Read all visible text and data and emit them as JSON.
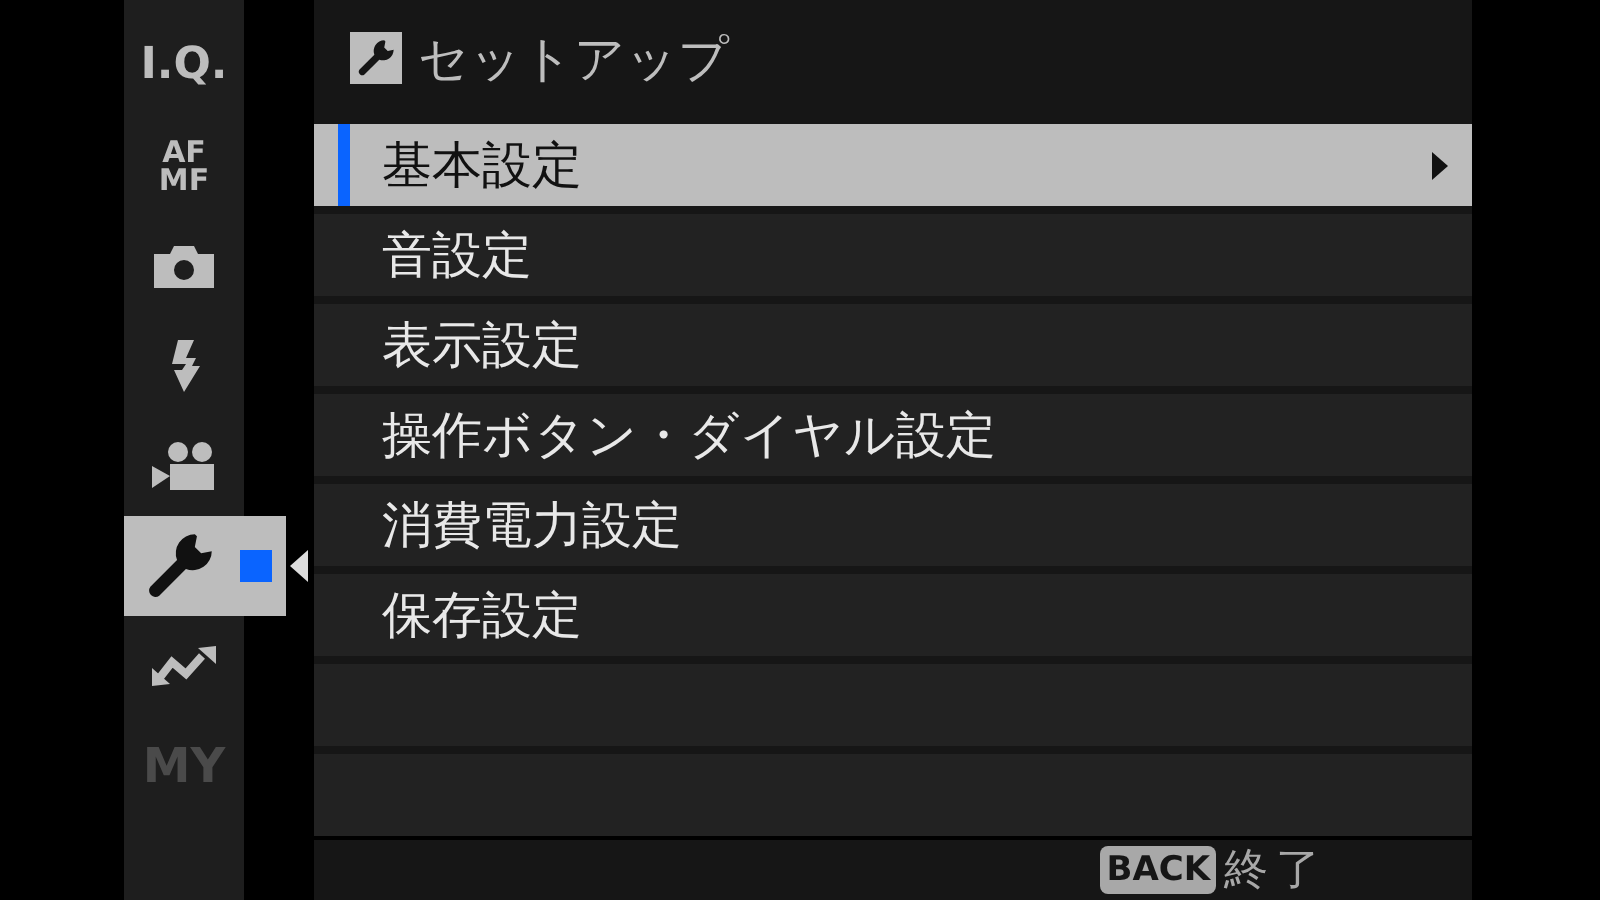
{
  "sidebar": {
    "items": [
      {
        "kind": "text",
        "label": "I.Q.",
        "selected": false,
        "disabled": false
      },
      {
        "kind": "text",
        "label": "AF\nMF",
        "selected": false,
        "disabled": false
      },
      {
        "kind": "icon",
        "selected": false,
        "disabled": false
      },
      {
        "kind": "icon",
        "selected": false,
        "disabled": false
      },
      {
        "kind": "icon",
        "selected": false,
        "disabled": false
      },
      {
        "kind": "icon",
        "selected": true,
        "disabled": false
      },
      {
        "kind": "icon",
        "selected": false,
        "disabled": false
      },
      {
        "kind": "text",
        "label": "MY",
        "selected": false,
        "disabled": true
      }
    ]
  },
  "menu": {
    "title": "セットアップ",
    "items": [
      {
        "label": "基本設定",
        "selected": true
      },
      {
        "label": "音設定",
        "selected": false
      },
      {
        "label": "表示設定",
        "selected": false
      },
      {
        "label": "操作ボタン・ダイヤル設定",
        "selected": false
      },
      {
        "label": "消費電力設定",
        "selected": false
      },
      {
        "label": "保存設定",
        "selected": false
      }
    ]
  },
  "footer": {
    "key": "BACK",
    "label": "終了"
  }
}
